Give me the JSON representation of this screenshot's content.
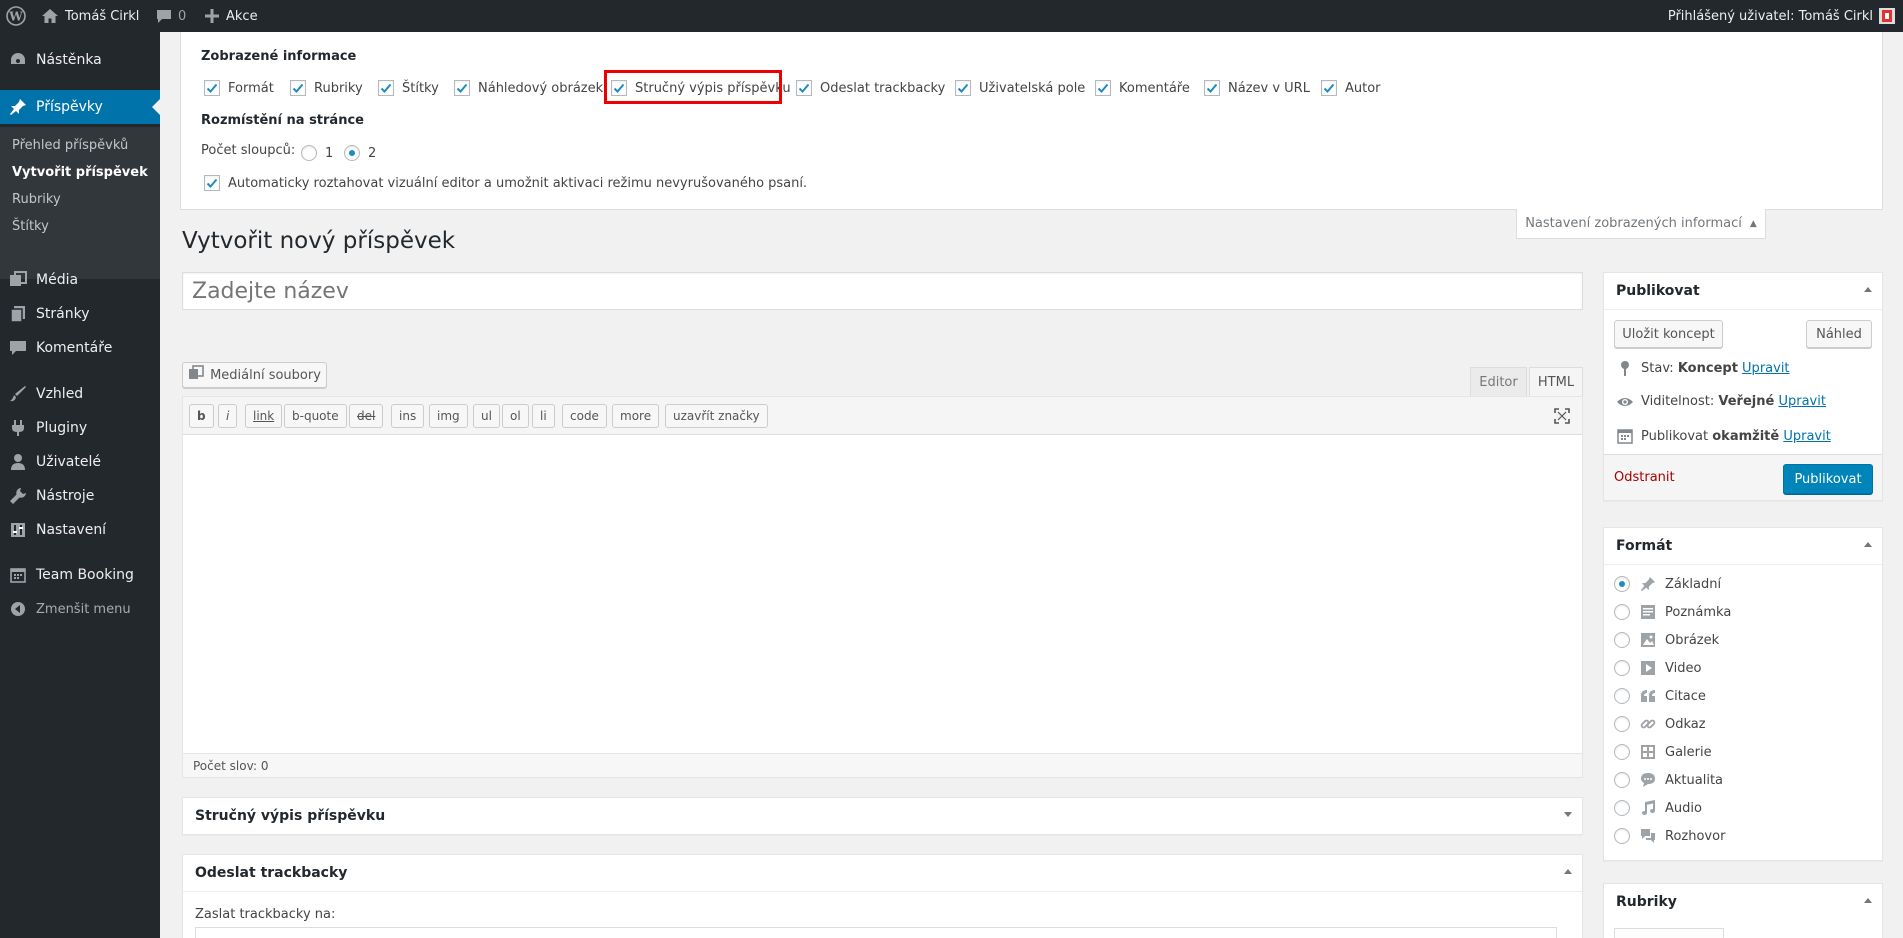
{
  "adminbar": {
    "site_name": "Tomáš Cirkl",
    "comments_count": "0",
    "new_label": "Akce",
    "greeting": "Přihlášený uživatel: Tomáš Cirkl"
  },
  "sidebar": {
    "items": [
      {
        "label": "Nástěnka",
        "icon": "dashboard-icon"
      },
      {
        "label": "Příspěvky",
        "icon": "pin-icon"
      },
      {
        "label": "Média",
        "icon": "media-icon"
      },
      {
        "label": "Stránky",
        "icon": "pages-icon"
      },
      {
        "label": "Komentáře",
        "icon": "comments-icon"
      },
      {
        "label": "Vzhled",
        "icon": "appearance-icon"
      },
      {
        "label": "Pluginy",
        "icon": "plugins-icon"
      },
      {
        "label": "Uživatelé",
        "icon": "users-icon"
      },
      {
        "label": "Nástroje",
        "icon": "tools-icon"
      },
      {
        "label": "Nastavení",
        "icon": "settings-icon"
      },
      {
        "label": "Team Booking",
        "icon": "calendar-icon"
      }
    ],
    "submenu": [
      "Přehled příspěvků",
      "Vytvořit příspěvek",
      "Rubriky",
      "Štítky"
    ],
    "collapse_label": "Zmenšit menu"
  },
  "screen_options": {
    "heading_boxes": "Zobrazené informace",
    "checkboxes": [
      "Formát",
      "Rubriky",
      "Štítky",
      "Náhledový obrázek",
      "Stručný výpis příspěvku",
      "Odeslat trackbacky",
      "Uživatelská pole",
      "Komentáře",
      "Název v URL",
      "Autor"
    ],
    "heading_layout": "Rozmístění na stránce",
    "columns_label": "Počet sloupců:",
    "column_options": [
      "1",
      "2"
    ],
    "column_selected": "2",
    "editor_expand": "Automaticky roztahovat vizuální editor a umožnit aktivaci režimu nevyrušovaného psaní.",
    "tab_label": "Nastavení zobrazených informací"
  },
  "page_title": "Vytvořit nový příspěvek",
  "title_placeholder": "Zadejte název",
  "editor": {
    "media_button": "Mediální soubory",
    "tab_visual": "Editor",
    "tab_html": "HTML",
    "quicktags": [
      "b",
      "i",
      "link",
      "b-quote",
      "del",
      "ins",
      "img",
      "ul",
      "ol",
      "li",
      "code",
      "more",
      "uzavřít značky"
    ],
    "word_count": "Počet slov: 0"
  },
  "metaboxes": {
    "excerpt_title": "Stručný výpis příspěvku",
    "trackbacks_title": "Odeslat trackbacky",
    "trackbacks_label": "Zaslat trackbacky na:"
  },
  "publish": {
    "title": "Publikovat",
    "save_draft": "Uložit koncept",
    "preview": "Náhled",
    "status_label": "Stav:",
    "status_value": "Koncept",
    "visibility_label": "Viditelnost:",
    "visibility_value": "Veřejné",
    "schedule_label": "Publikovat",
    "schedule_value": "okamžitě",
    "edit_link": "Upravit",
    "delete_link": "Odstranit",
    "publish_button": "Publikovat"
  },
  "format_box": {
    "title": "Formát",
    "options": [
      {
        "label": "Základní",
        "icon": "pin-icon"
      },
      {
        "label": "Poznámka",
        "icon": "aside-icon"
      },
      {
        "label": "Obrázek",
        "icon": "image-icon"
      },
      {
        "label": "Video",
        "icon": "video-icon"
      },
      {
        "label": "Citace",
        "icon": "quote-icon"
      },
      {
        "label": "Odkaz",
        "icon": "link-icon"
      },
      {
        "label": "Galerie",
        "icon": "gallery-icon"
      },
      {
        "label": "Aktualita",
        "icon": "status-icon"
      },
      {
        "label": "Audio",
        "icon": "audio-icon"
      },
      {
        "label": "Rozhovor",
        "icon": "chat-icon"
      }
    ],
    "selected": "Základní"
  },
  "categories_box": {
    "title": "Rubriky"
  },
  "colors": {
    "adminbar_bg": "#23282d",
    "active_menu": "#0073aa",
    "publish_button": "#0085ba",
    "highlight": "#ee0000",
    "delete_link": "#a00000"
  }
}
